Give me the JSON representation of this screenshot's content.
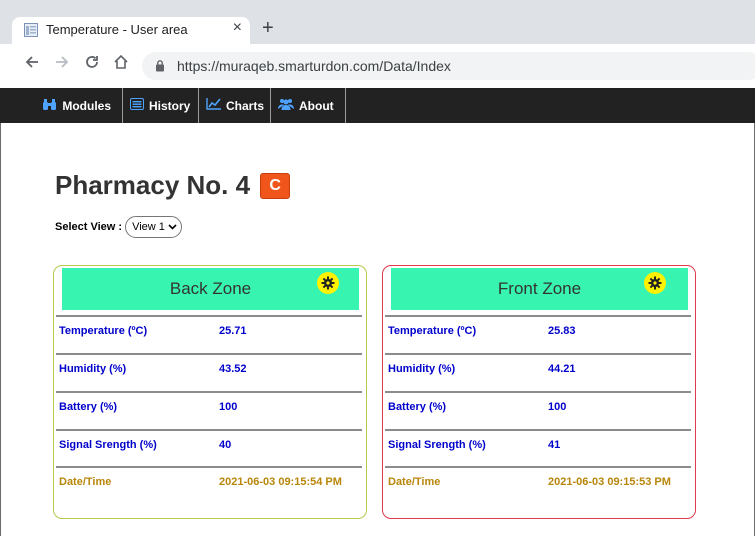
{
  "browser": {
    "tab_title": "Temperature - User area",
    "close_glyph": "×",
    "new_tab_glyph": "+",
    "url": "https://muraqeb.smarturdon.com/Data/Index"
  },
  "navbar": {
    "modules": "Modules",
    "history": "History",
    "charts": "Charts",
    "about": "About"
  },
  "page": {
    "title": "Pharmacy No. 4",
    "refresh_glyph": "C",
    "select_label": "Select View :",
    "select_value": "View 1"
  },
  "zones": [
    {
      "name": "Back Zone",
      "rows": [
        {
          "label": "Temperature (ºC)",
          "value": "25.71"
        },
        {
          "label": "Humidity (%)",
          "value": "43.52"
        },
        {
          "label": "Battery (%)",
          "value": "100"
        },
        {
          "label": "Signal Srength (%)",
          "value": "40"
        },
        {
          "label": "Date/Time",
          "value": "2021-06-03 09:15:54 PM"
        }
      ]
    },
    {
      "name": "Front Zone",
      "rows": [
        {
          "label": "Temperature (ºC)",
          "value": "25.83"
        },
        {
          "label": "Humidity (%)",
          "value": "44.21"
        },
        {
          "label": "Battery (%)",
          "value": "100"
        },
        {
          "label": "Signal Srength (%)",
          "value": "41"
        },
        {
          "label": "Date/Time",
          "value": "2021-06-03 09:15:53 PM"
        }
      ]
    }
  ],
  "colors": {
    "zone_header": "#37f5b1",
    "back_zone_border": "#b8c94e",
    "front_zone_border": "#df3a4e",
    "label_blue": "#0000cd",
    "datetime_gold": "#b8860b",
    "refresh_orange": "#f0561c",
    "gear_yellow": "#fff200",
    "navbar_bg": "#222222"
  }
}
